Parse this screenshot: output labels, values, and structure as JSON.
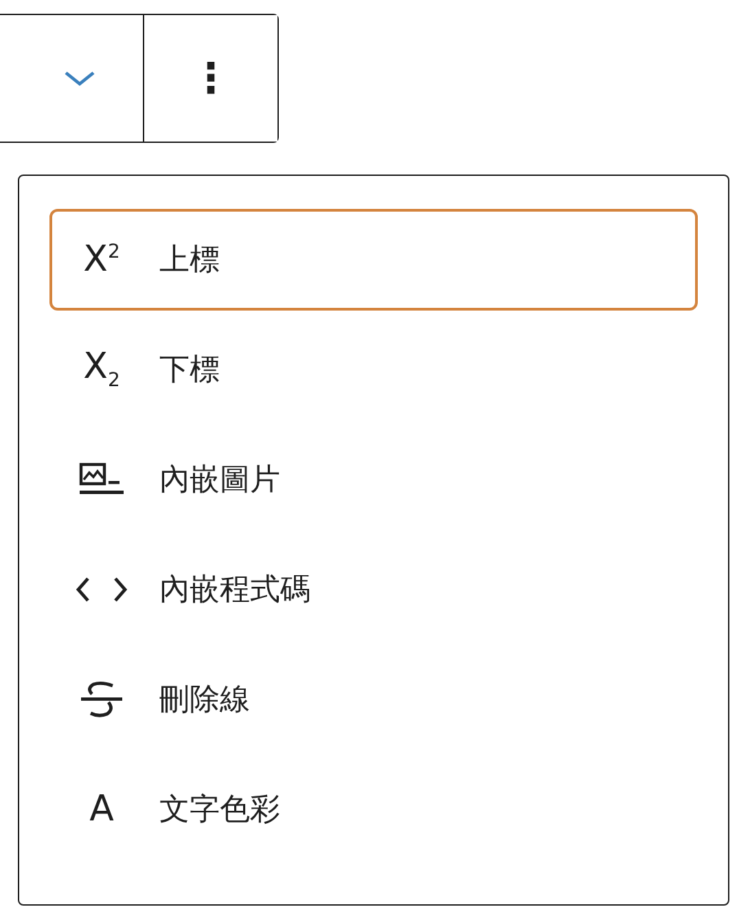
{
  "toolbar": {
    "dropdown": {
      "expanded": true
    },
    "more_button": {
      "label": "⋮"
    }
  },
  "menu": {
    "items": [
      {
        "kind": "superscript",
        "glyph": "X$^{2}$",
        "label": "上標",
        "selected": true
      },
      {
        "kind": "subscript",
        "glyph": "X$_{2}$",
        "label": "下標",
        "selected": false
      },
      {
        "kind": "image",
        "label": "內嵌圖片",
        "selected": false
      },
      {
        "kind": "code",
        "label": "內嵌程式碼",
        "selected": false
      },
      {
        "kind": "strikethrough",
        "label": "刪除線",
        "selected": false
      },
      {
        "kind": "color",
        "glyph": "A",
        "label": "文字色彩",
        "selected": false
      }
    ]
  }
}
